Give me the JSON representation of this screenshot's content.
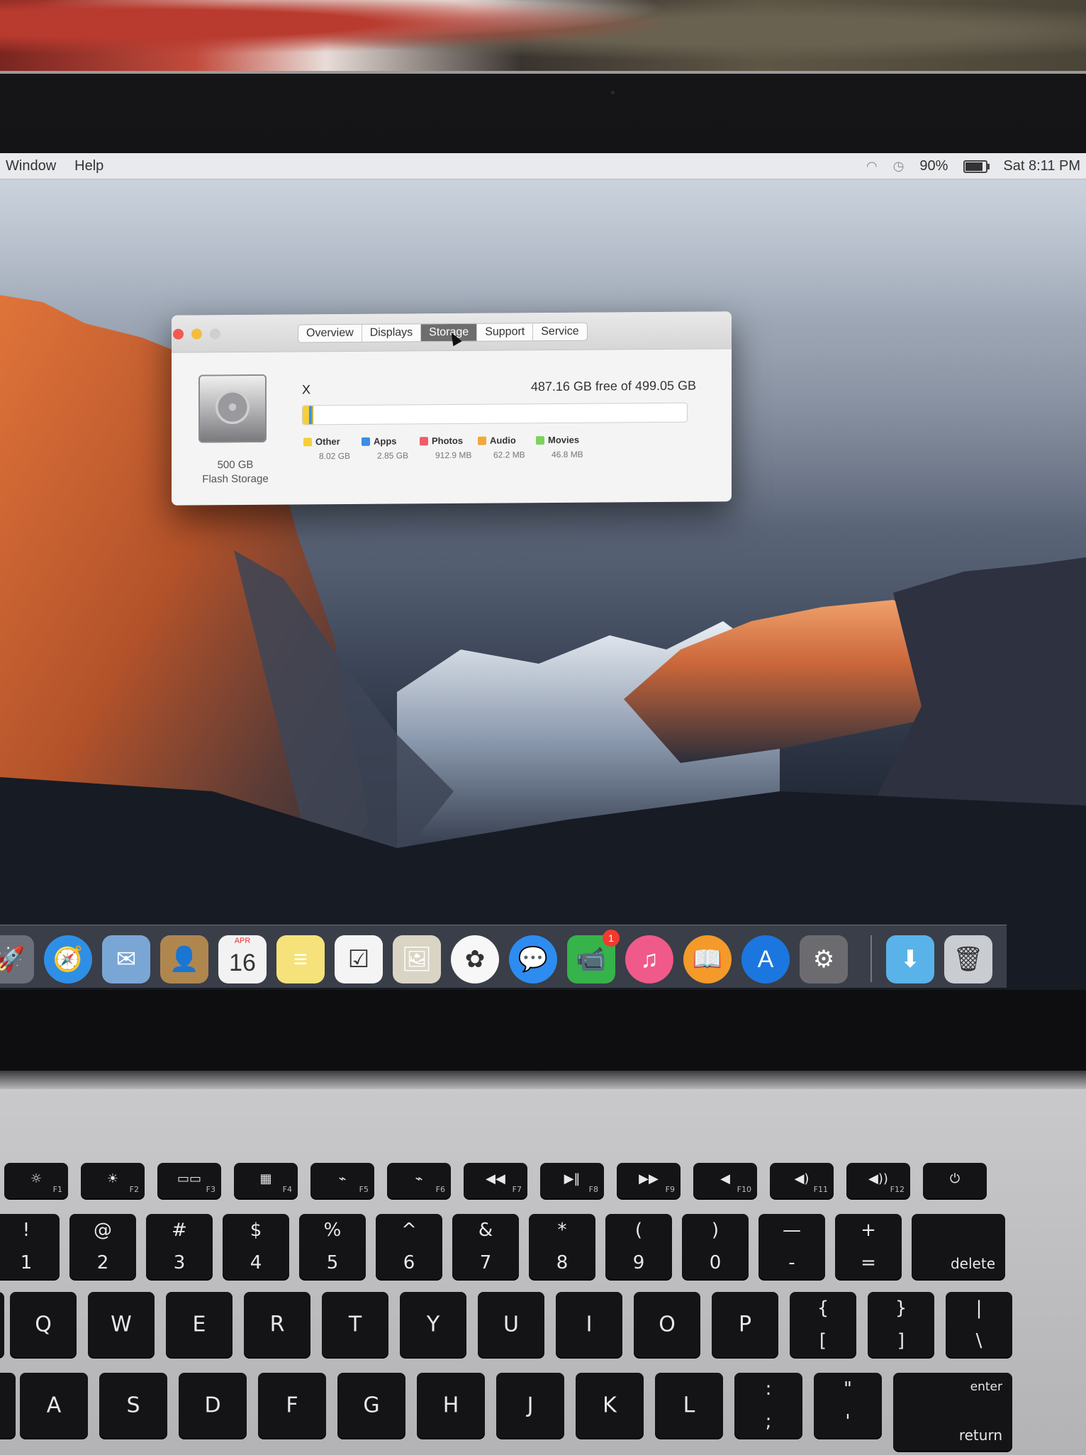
{
  "menubar": {
    "left_items": [
      "Window",
      "Help"
    ],
    "battery_percent": "90%",
    "battery_level": 0.9,
    "clock": "Sat 8:11 PM"
  },
  "about_window": {
    "tabs": [
      "Overview",
      "Displays",
      "Storage",
      "Support",
      "Service"
    ],
    "active_tab": "Storage",
    "drive": {
      "capacity": "500 GB",
      "type": "Flash Storage"
    },
    "volume_name": "X",
    "free_text": "487.16 GB free of 499.05 GB",
    "legend": [
      {
        "label": "Other",
        "size": "8.02 GB",
        "color": "#f5cf3b"
      },
      {
        "label": "Apps",
        "size": "2.85 GB",
        "color": "#3a8ee6"
      },
      {
        "label": "Photos",
        "size": "912.9 MB",
        "color": "#ef5c6a"
      },
      {
        "label": "Audio",
        "size": "62.2 MB",
        "color": "#f3a83a"
      },
      {
        "label": "Movies",
        "size": "46.8 MB",
        "color": "#7cd35a"
      }
    ],
    "usage_fractions": [
      0.0161,
      0.0057,
      0.0018,
      0.0001,
      0.0001
    ]
  },
  "dock": {
    "items": [
      {
        "name": "launchpad",
        "glyph": "🚀",
        "color": "#6a6f7a"
      },
      {
        "name": "safari",
        "glyph": "🧭",
        "color": "#2f8fe6"
      },
      {
        "name": "mail",
        "glyph": "✉",
        "color": "#7aa6d6"
      },
      {
        "name": "contacts",
        "glyph": "👤",
        "color": "#b0864f"
      },
      {
        "name": "calendar",
        "glyph": "16",
        "color": "#f2f2f2"
      },
      {
        "name": "notes",
        "glyph": "≡",
        "color": "#f6e27a"
      },
      {
        "name": "reminders",
        "glyph": "☑",
        "color": "#f4f4f4"
      },
      {
        "name": "preview",
        "glyph": "🖼",
        "color": "#d9d4c4"
      },
      {
        "name": "photos",
        "glyph": "✿",
        "color": "#f7f7f7"
      },
      {
        "name": "messages",
        "glyph": "💬",
        "color": "#2d8cf0"
      },
      {
        "name": "facetime",
        "glyph": "📹",
        "color": "#36b34a"
      },
      {
        "name": "itunes",
        "glyph": "♫",
        "color": "#f05a8a"
      },
      {
        "name": "ibooks",
        "glyph": "📖",
        "color": "#f39a2b"
      },
      {
        "name": "app-store",
        "glyph": "A",
        "color": "#1b76e0"
      },
      {
        "name": "system-preferences",
        "glyph": "⚙",
        "color": "#6c6c70"
      },
      {
        "name": "downloads-folder",
        "glyph": "⬇",
        "color": "#59b3e8"
      },
      {
        "name": "trash",
        "glyph": "🗑",
        "color": "#c9ccd1"
      }
    ],
    "calendar_month": "APR",
    "facetime_badge": "1"
  },
  "keyboard": {
    "fn_row": [
      {
        "glyph": "☼",
        "label": "F1"
      },
      {
        "glyph": "☀",
        "label": "F2"
      },
      {
        "glyph": "▭▭",
        "label": "F3"
      },
      {
        "glyph": "▦",
        "label": "F4"
      },
      {
        "glyph": "⌁",
        "label": "F5"
      },
      {
        "glyph": "⌁",
        "label": "F6"
      },
      {
        "glyph": "◀◀",
        "label": "F7"
      },
      {
        "glyph": "▶‖",
        "label": "F8"
      },
      {
        "glyph": "▶▶",
        "label": "F9"
      },
      {
        "glyph": "◀",
        "label": "F10"
      },
      {
        "glyph": "◀)",
        "label": "F11"
      },
      {
        "glyph": "◀))",
        "label": "F12"
      },
      {
        "glyph": "⏻",
        "label": ""
      }
    ],
    "number_row": [
      {
        "top": "!",
        "bot": "1"
      },
      {
        "top": "@",
        "bot": "2"
      },
      {
        "top": "#",
        "bot": "3"
      },
      {
        "top": "$",
        "bot": "4"
      },
      {
        "top": "%",
        "bot": "5"
      },
      {
        "top": "^",
        "bot": "6"
      },
      {
        "top": "&",
        "bot": "7"
      },
      {
        "top": "*",
        "bot": "8"
      },
      {
        "top": "(",
        "bot": "9"
      },
      {
        "top": ")",
        "bot": "0"
      },
      {
        "top": "—",
        "bot": "-"
      },
      {
        "top": "+",
        "bot": "="
      }
    ],
    "delete_label": "delete",
    "qwerty_row": [
      "Q",
      "W",
      "E",
      "R",
      "T",
      "Y",
      "U",
      "I",
      "O",
      "P"
    ],
    "bracket_keys": [
      {
        "top": "{",
        "bot": "["
      },
      {
        "top": "}",
        "bot": "]"
      },
      {
        "top": "|",
        "bot": "\\"
      }
    ],
    "home_row": [
      "A",
      "S",
      "D",
      "F",
      "G",
      "H",
      "J",
      "K",
      "L"
    ],
    "punct_keys": [
      {
        "top": ":",
        "bot": ";"
      },
      {
        "top": "\"",
        "bot": "'"
      }
    ],
    "enter_label": "enter",
    "return_label": "return"
  }
}
